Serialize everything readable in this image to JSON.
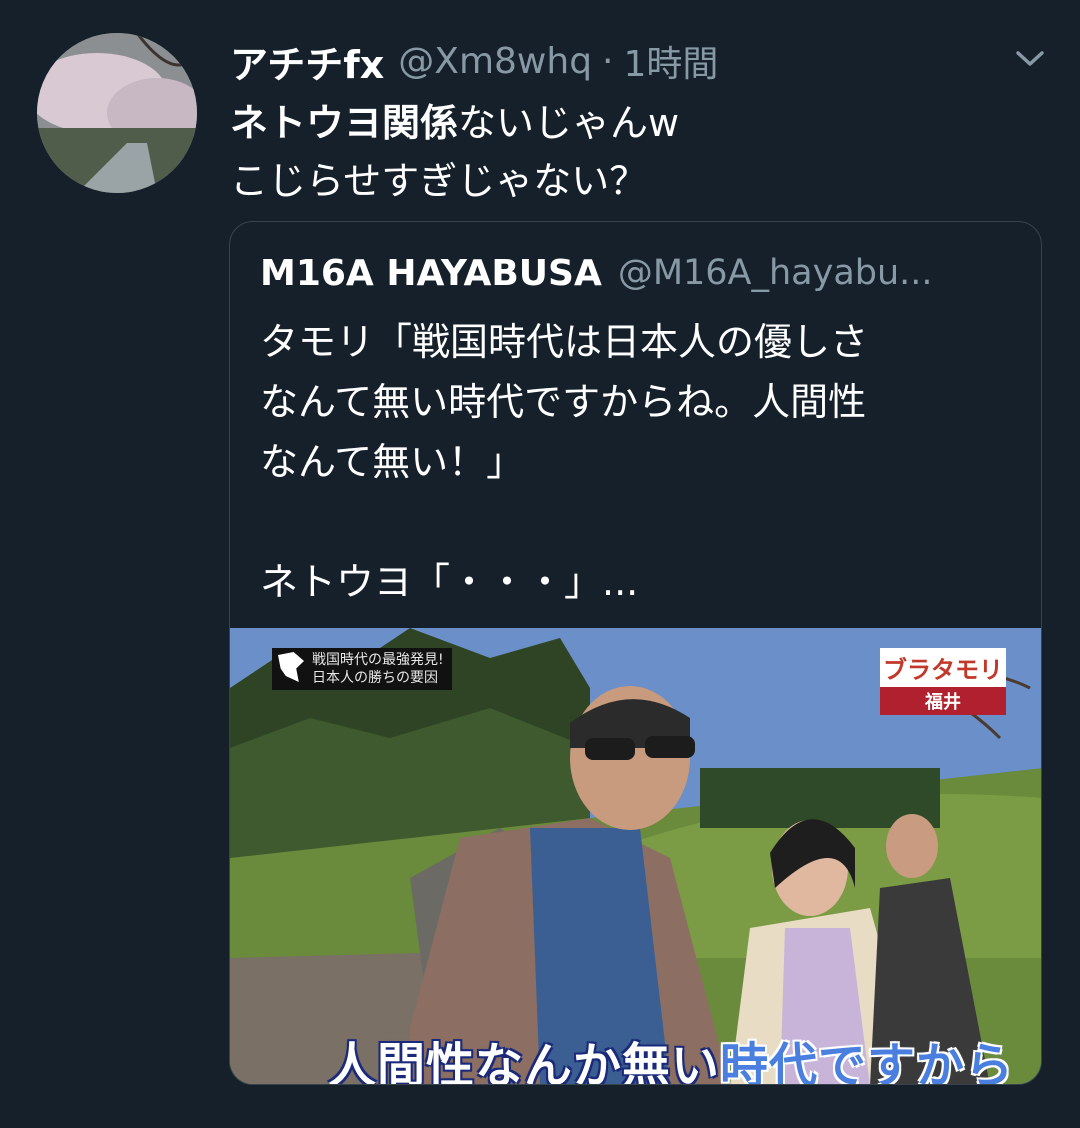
{
  "tweet": {
    "author_name": "アチチfx",
    "author_handle": "@Xm8whq",
    "separator": "·",
    "time": "1時間",
    "text_line1_bold": "ネトウヨ関係",
    "text_line1_rest": "ないじゃんw",
    "text_line2": "こじらせすぎじゃない？"
  },
  "quoted_tweet": {
    "author_name": "M16A  HAYABUSA",
    "author_handle": "@M16A_hayabu...",
    "text_lines": [
      "タモリ「戦国時代は日本人の優しさ",
      "なんて無い時代ですからね。人間性",
      "なんて無い！」",
      "",
      "ネトウヨ「・・・」..."
    ],
    "media": {
      "caption_white": "人間性なんか無い",
      "caption_blue": "時代ですから",
      "brand_line1": "ブラタモリ",
      "brand_line2": "福井",
      "top_caption_line1": "戦国時代の最強発見!",
      "top_caption_line2": "日本人の勝ちの要因"
    }
  },
  "icons": [
    "avatar",
    "chevron-down-icon"
  ],
  "colors": {
    "background": "#15202b",
    "secondary_text": "#8899a6",
    "border": "#38444d"
  }
}
